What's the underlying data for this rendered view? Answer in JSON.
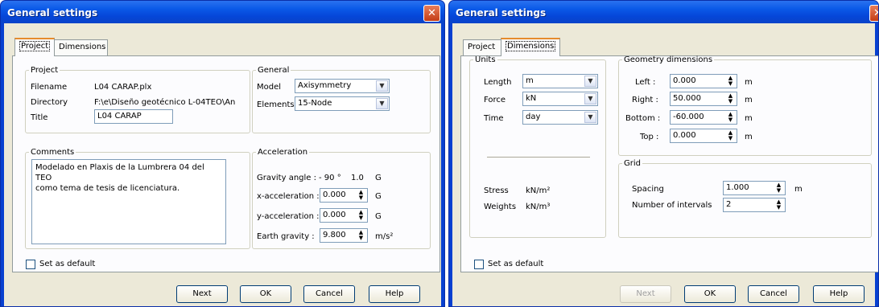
{
  "left": {
    "title": "General settings",
    "tabs": [
      "Project",
      "Dimensions"
    ],
    "project": {
      "legend": "Project",
      "filename_label": "Filename",
      "filename_value": "L04 CARAP.plx",
      "directory_label": "Directory",
      "directory_value": "F:\\e\\Diseño geotécnico L-04TEO\\An",
      "title_label": "Title",
      "title_value": "L04 CARAP"
    },
    "general": {
      "legend": "General",
      "model_label": "Model",
      "model_value": "Axisymmetry",
      "elements_label": "Elements",
      "elements_value": "15-Node"
    },
    "comments": {
      "legend": "Comments",
      "line1": "Modelado en Plaxis de la Lumbrera 04 del TEO",
      "line2": "como tema de tesis de licenciatura."
    },
    "acceleration": {
      "legend": "Acceleration",
      "gravity_angle_label": "Gravity angle :",
      "gravity_angle_value": "- 90 °",
      "gravity_g_value": "1.0",
      "gravity_g_unit": "G",
      "x_label": "x-acceleration :",
      "x_value": "0.000",
      "x_unit": "G",
      "y_label": "y-acceleration :",
      "y_value": "0.000",
      "y_unit": "G",
      "earth_label": "Earth gravity :",
      "earth_value": "9.800",
      "earth_unit": "m/s²"
    },
    "default_label": "Set as default",
    "buttons": {
      "next": "Next",
      "ok": "OK",
      "cancel": "Cancel",
      "help": "Help"
    }
  },
  "right": {
    "title": "General settings",
    "tabs": [
      "Project",
      "Dimensions"
    ],
    "units": {
      "legend": "Units",
      "length_label": "Length",
      "length_value": "m",
      "force_label": "Force",
      "force_value": "kN",
      "time_label": "Time",
      "time_value": "day",
      "stress_label": "Stress",
      "stress_value": "kN/m²",
      "weights_label": "Weights",
      "weights_value": "kN/m³"
    },
    "geometry": {
      "legend": "Geometry dimensions",
      "left_label": "Left :",
      "left_value": "0.000",
      "right_label": "Right :",
      "right_value": "50.000",
      "bottom_label": "Bottom :",
      "bottom_value": "-60.000",
      "top_label": "Top :",
      "top_value": "0.000",
      "unit": "m"
    },
    "grid": {
      "legend": "Grid",
      "spacing_label": "Spacing",
      "spacing_value": "1.000",
      "spacing_unit": "m",
      "intervals_label": "Number of intervals",
      "intervals_value": "2"
    },
    "default_label": "Set as default",
    "buttons": {
      "next": "Next",
      "ok": "OK",
      "cancel": "Cancel",
      "help": "Help"
    }
  }
}
